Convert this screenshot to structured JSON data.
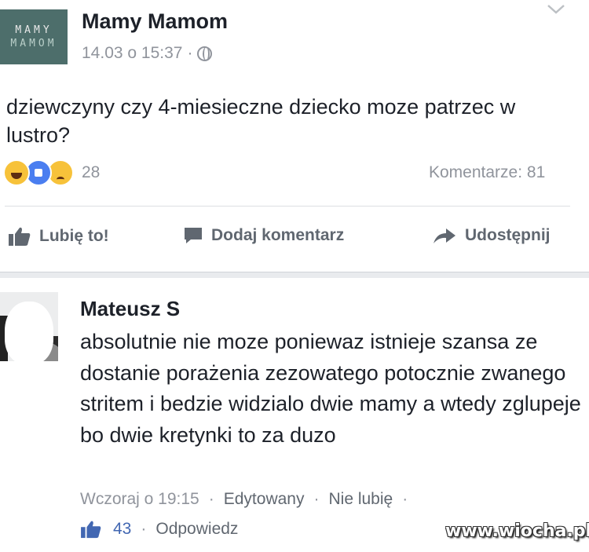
{
  "post": {
    "logo_line1": "MAMY",
    "logo_line2": "MAMOM",
    "page_name": "Mamy Mamom",
    "timestamp": "14.03 o 15:37",
    "separator": "·",
    "text": "dziewczyny czy 4-miesieczne dziecko moze patrzec w lustro?",
    "reactions": {
      "types": [
        "haha",
        "like",
        "sad"
      ],
      "count": "28"
    },
    "comments_label": "Komentarze: 81",
    "actions": {
      "like": "Lubię to!",
      "comment": "Dodaj komentarz",
      "share": "Udostępnij"
    }
  },
  "comment": {
    "author": "Mateusz S",
    "text": "absolutnie nie moze poniewaz istnieje szansa ze dostanie porażenia zezowatego potocznie zwanego stritem i bedzie widzialo dwie mamy a wtedy zglupeje bo dwie kretynki to za duzo",
    "time": "Wczoraj o 19:15",
    "edited": "Edytowany",
    "unlike": "Nie lubię",
    "dot": "·",
    "like_count": "43",
    "reply": "Odpowiedz"
  },
  "watermark": "www.wiocha.pl",
  "colors": {
    "text": "#1d2129",
    "muted": "#90949c",
    "like_blue": "#4267b2",
    "logo_bg": "#4d6e6b"
  }
}
